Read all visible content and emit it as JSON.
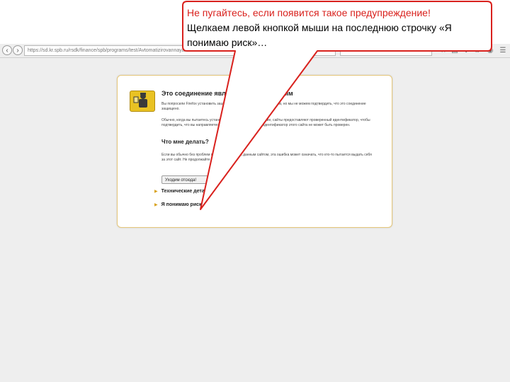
{
  "toolbar": {
    "url": "https://sd.kr.spb.ru/rsdk/finance/spb/programs/test/Avtomatizirovannaya.html",
    "search_placeholder": "Поиск"
  },
  "error_page": {
    "title": "Это соединение является недоверенным",
    "paragraph_1": "Вы попросили Firefox установить защищённое соединение с веб-сайтом, но мы не можем подтвердить, что это соединение защищено.",
    "paragraph_2": "Обычно, когда вы пытаетесь установить защищённое соединение, сайты предоставляют проверенный идентификатор, чтобы подтвердить, что вы направляетесь в нужное место. Однако идентификатор этого сайта не может быть проверен.",
    "subtitle": "Что мне делать?",
    "paragraph_3": "Если вы обычно без проблем подсоединяетесь к данным сайтом, эта ошибка может означать, что кто-то пытается выдать себя за этот сайт. Не продолжайте соединение.",
    "leave_button": "Уходим отсюда!",
    "expander_technical": "Технические детали",
    "expander_risk": "Я понимаю риск"
  },
  "callout": {
    "line1": "Не пугайтесь, если появится такое предупреждение!",
    "line2": "Щелкаем левой кнопкой мыши на последнюю строчку «Я",
    "line3": "понимаю риск»…",
    "border_color": "#d9211d"
  }
}
